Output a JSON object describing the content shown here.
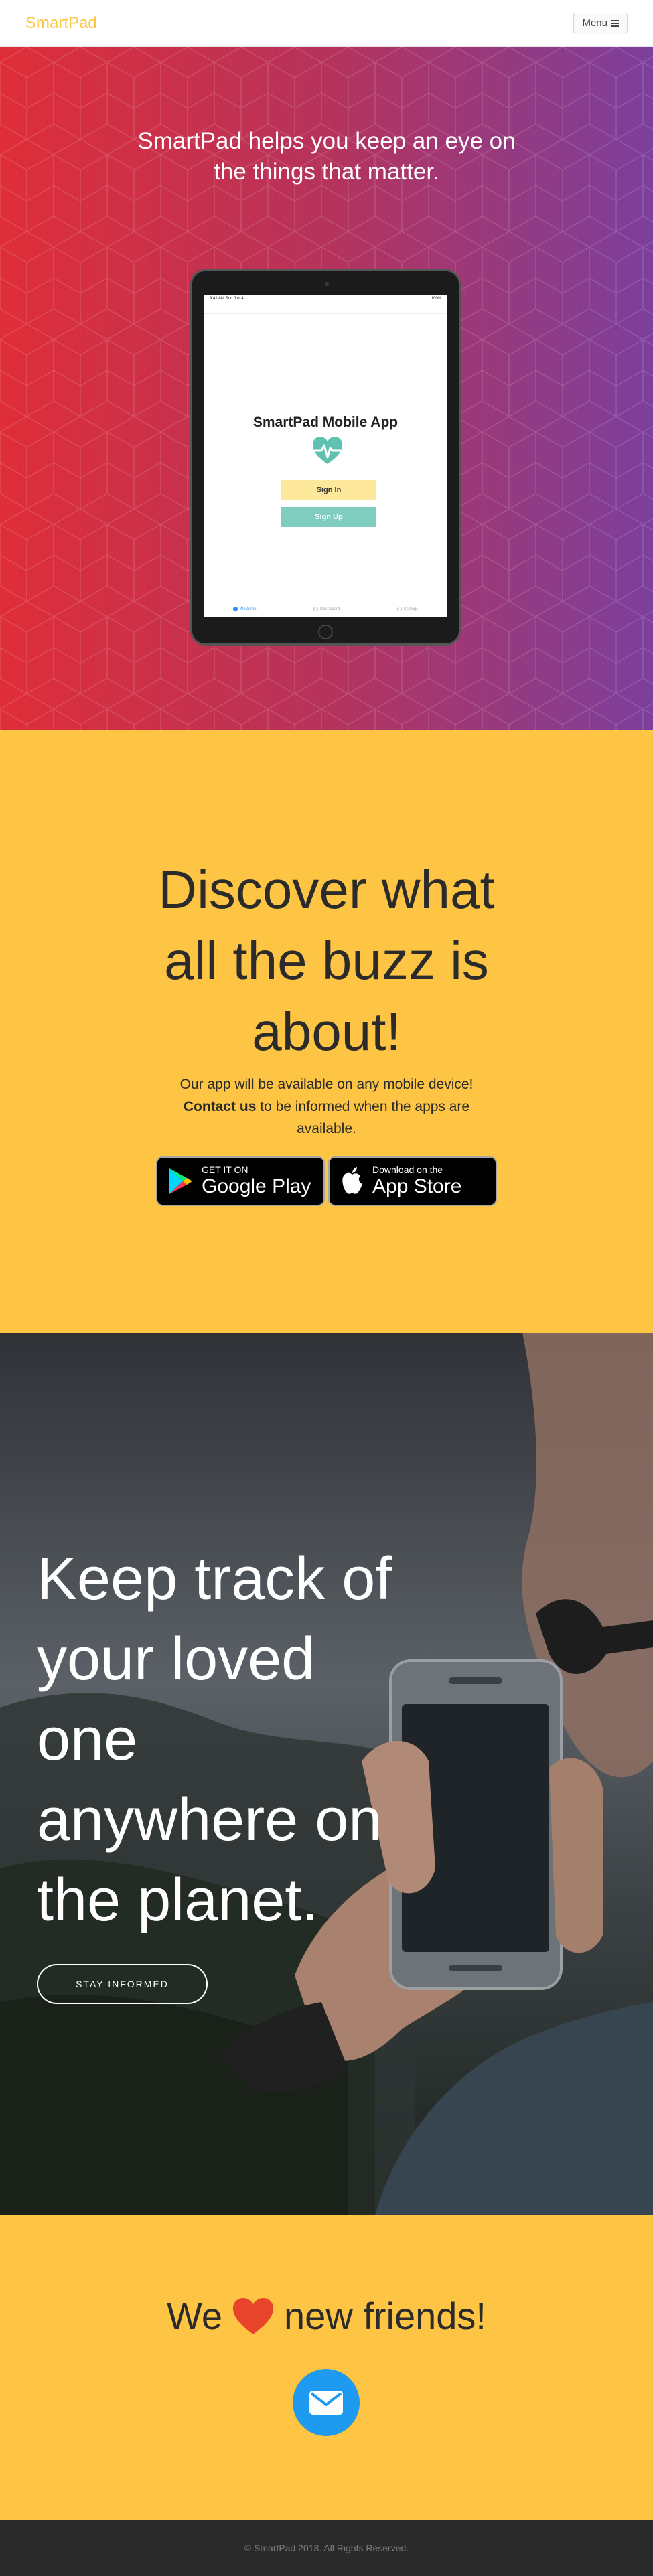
{
  "navbar": {
    "brand": "SmartPad",
    "menu_label": "Menu"
  },
  "hero": {
    "title_line1": "SmartPad helps you keep an eye on",
    "title_line2": "the things that matter.",
    "tablet": {
      "status_left": "9:41 AM  Sun Jun 4",
      "status_right": "100%",
      "app_title": "SmartPad Mobile App",
      "signin_label": "Sign In",
      "signup_label": "Sign Up",
      "tabs": [
        "Welcome",
        "Dashboard",
        "Settings"
      ]
    }
  },
  "download": {
    "title_line1": "Discover what",
    "title_line2": "all the buzz is",
    "title_line3": "about!",
    "text_line1": "Our app will be available on any mobile device!",
    "contact_link": "Contact us",
    "text_line2_rest": " to be informed when the apps are",
    "text_line3": "available.",
    "google_small": "GET IT ON",
    "google_big": "Google Play",
    "apple_small": "Download on the",
    "apple_big": "App Store"
  },
  "track": {
    "title_line1": "Keep track of",
    "title_line2": "your loved",
    "title_line3": "one",
    "title_line4": "anywhere on",
    "title_line5": "the planet.",
    "button_label": "STAY INFORMED"
  },
  "friends": {
    "before_heart": "We",
    "after_heart": "new friends!"
  },
  "footer": {
    "copyright": "© SmartPad 2018. All Rights Reserved."
  },
  "colors": {
    "accent_yellow": "#fdc543",
    "hero_red": "#df2e38",
    "hero_purple": "#7c3f9d",
    "mail_blue": "#1e9bf0",
    "heart_red": "#e8442c",
    "footer_dark": "#2a2a2a"
  },
  "icons": {
    "menu": "menu-bars-icon",
    "heart_pulse": "heart-pulse-icon",
    "google_play": "google-play-icon",
    "apple": "apple-icon",
    "heart": "heart-icon",
    "mail": "envelope-icon"
  }
}
